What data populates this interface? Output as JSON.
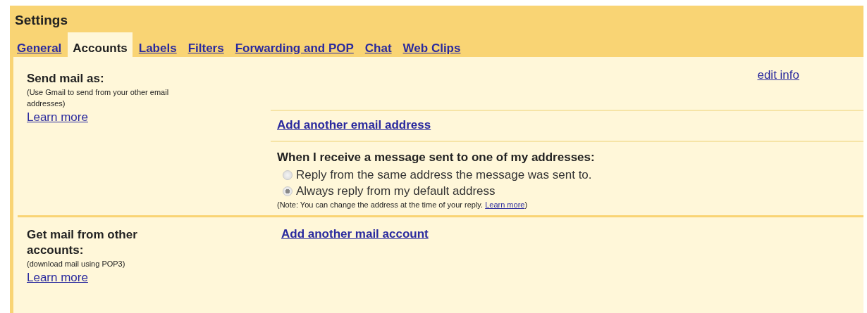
{
  "window": {
    "title": "Settings"
  },
  "tabs": [
    {
      "label": "General",
      "selected": false
    },
    {
      "label": "Accounts",
      "selected": true
    },
    {
      "label": "Labels",
      "selected": false
    },
    {
      "label": "Filters",
      "selected": false
    },
    {
      "label": "Forwarding and POP",
      "selected": false
    },
    {
      "label": "Chat",
      "selected": false
    },
    {
      "label": "Web Clips",
      "selected": false
    }
  ],
  "sections": [
    {
      "heading": "Send mail as:",
      "description": "(Use Gmail to send from your other email addresses)",
      "learn_more": "Learn more",
      "rows": [
        {
          "kind": "info",
          "link": "edit info"
        },
        {
          "kind": "link",
          "link": "Add another email address"
        },
        {
          "kind": "options",
          "heading": "When I receive a message sent to one of my addresses:",
          "options": [
            {
              "label": "Reply from the same address the message was sent to.",
              "selected": false
            },
            {
              "label": "Always reply from my default address",
              "selected": true
            }
          ],
          "note": "(Note: You can change the address at the time of your reply.",
          "note_link": "Learn more",
          "note_end": ")"
        }
      ]
    },
    {
      "heading": "Get mail from other accounts:",
      "description": "(download mail using POP3)",
      "learn_more": "Learn more",
      "rows": [
        {
          "kind": "link",
          "link": "Add another mail account"
        }
      ]
    }
  ]
}
